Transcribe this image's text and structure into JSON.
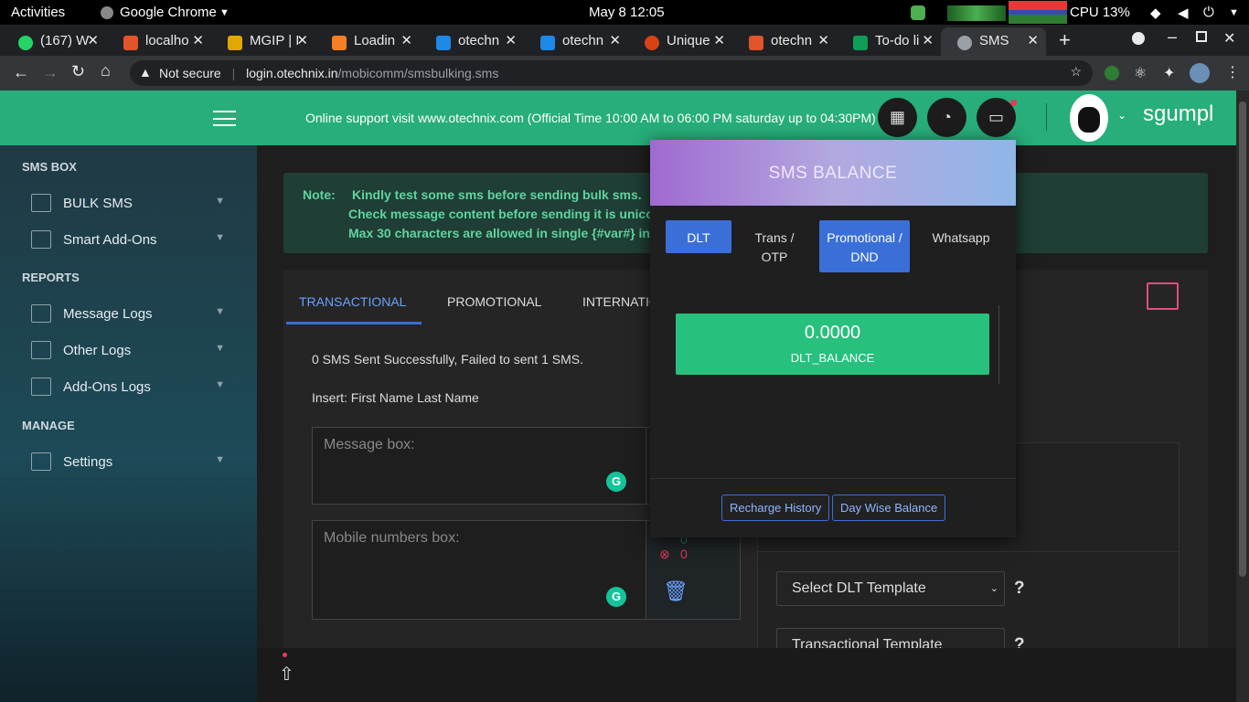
{
  "os": {
    "activities": "Activities",
    "app": "Google Chrome",
    "date": "May 8  12:05",
    "cpu": "CPU 13%"
  },
  "browser": {
    "tabs": [
      {
        "label": "(167) W",
        "color": "#25d366"
      },
      {
        "label": "localho",
        "color": "#e0552b"
      },
      {
        "label": "MGIP | I",
        "color": "#e0a800"
      },
      {
        "label": "Loadin",
        "color": "#f48024"
      },
      {
        "label": "otechn",
        "color": "#1e88e5"
      },
      {
        "label": "otechn",
        "color": "#1e88e5"
      },
      {
        "label": "Unique",
        "color": "#d84315"
      },
      {
        "label": "otechn",
        "color": "#e0552b"
      },
      {
        "label": "To-do li",
        "color": "#0f9d58"
      },
      {
        "label": "SMS",
        "color": "#9aa0a6"
      }
    ],
    "not_secure": "Not secure",
    "url_host": "login.otechnix.in",
    "url_path": "/mobicomm/smsbulking.sms"
  },
  "sidebar": {
    "sections": [
      "SMS BOX",
      "REPORTS",
      "MANAGE"
    ],
    "items": [
      {
        "label": "BULK SMS",
        "icon": "chat-bubble-icon"
      },
      {
        "label": "Smart Add-Ons",
        "icon": "layers-icon"
      },
      {
        "label": "Message Logs",
        "icon": "clipboard-icon"
      },
      {
        "label": "Other Logs",
        "icon": "document-icon"
      },
      {
        "label": "Add-Ons Logs",
        "icon": "list-icon"
      },
      {
        "label": "Settings",
        "icon": "settings-icon"
      }
    ]
  },
  "header": {
    "support": "Online support visit www.otechnix.com (Official Time 10:00 AM to 06:00 PM saturday up to 04:30PM)",
    "username": "sgumpl"
  },
  "note": {
    "label": "Note:",
    "line1": "Kindly test some sms before sending bulk sms.",
    "line2": "Check message content before sending it is unico",
    "line3": "Max 30 characters are allowed in single {#var#} in"
  },
  "main": {
    "tabs": [
      "TRANSACTIONAL",
      "PROMOTIONAL",
      "INTERNATIO"
    ],
    "status": "0 SMS Sent Successfully, Failed to sent 1 SMS.",
    "insert": "Insert: First Name Last Name",
    "message_placeholder": "Message box:",
    "mobile_placeholder": "Mobile numbers box:",
    "count_ok": "0",
    "count_fail": "0",
    "dlt_template": "Select DLT Template",
    "trans_template": "Transactional Template",
    "help": "?"
  },
  "popup": {
    "title": "SMS BALANCE",
    "tabs": [
      "DLT",
      "Trans / OTP",
      "Promotional / DND",
      "Whatsapp"
    ],
    "balance": "0.0000",
    "balance_label": "DLT_BALANCE",
    "recharge": "Recharge History",
    "daywise": "Day Wise Balance"
  }
}
